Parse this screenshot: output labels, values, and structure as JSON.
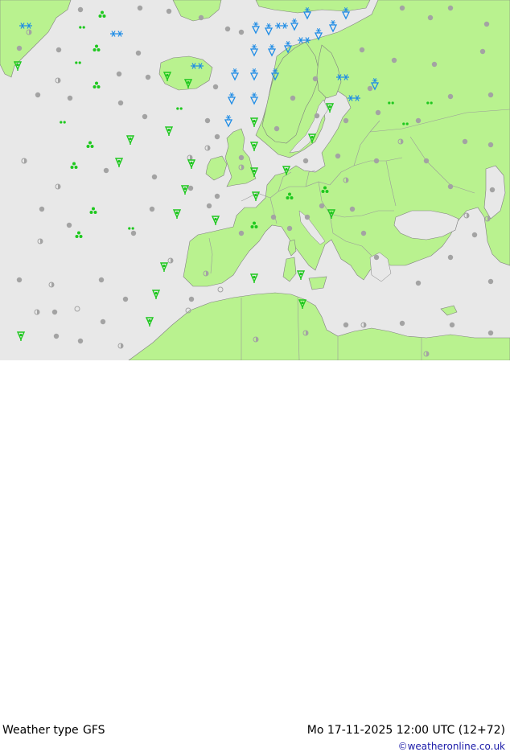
{
  "header": {
    "title": "Weather type",
    "model": "GFS",
    "valid_time": "Mo 17-11-2025 12:00 UTC (12+72)",
    "credit": "©weatheronline.co.uk"
  },
  "colors": {
    "sea": "#e8e8e8",
    "land": "#b9f28f",
    "border": "#9a9a9a",
    "coast": "#808080",
    "cloud_symbol": "#a3a3a3",
    "rain_symbol": "#1ec81e",
    "snow_symbol": "#1e8ce6"
  },
  "map": {
    "region": "Europe and North Atlantic",
    "legend_icons": [
      "cloud-icon",
      "partly-cloudy-icon",
      "drizzle-icon",
      "rain-icon",
      "shower-icon",
      "snow-icon",
      "snow-shower-icon"
    ]
  }
}
